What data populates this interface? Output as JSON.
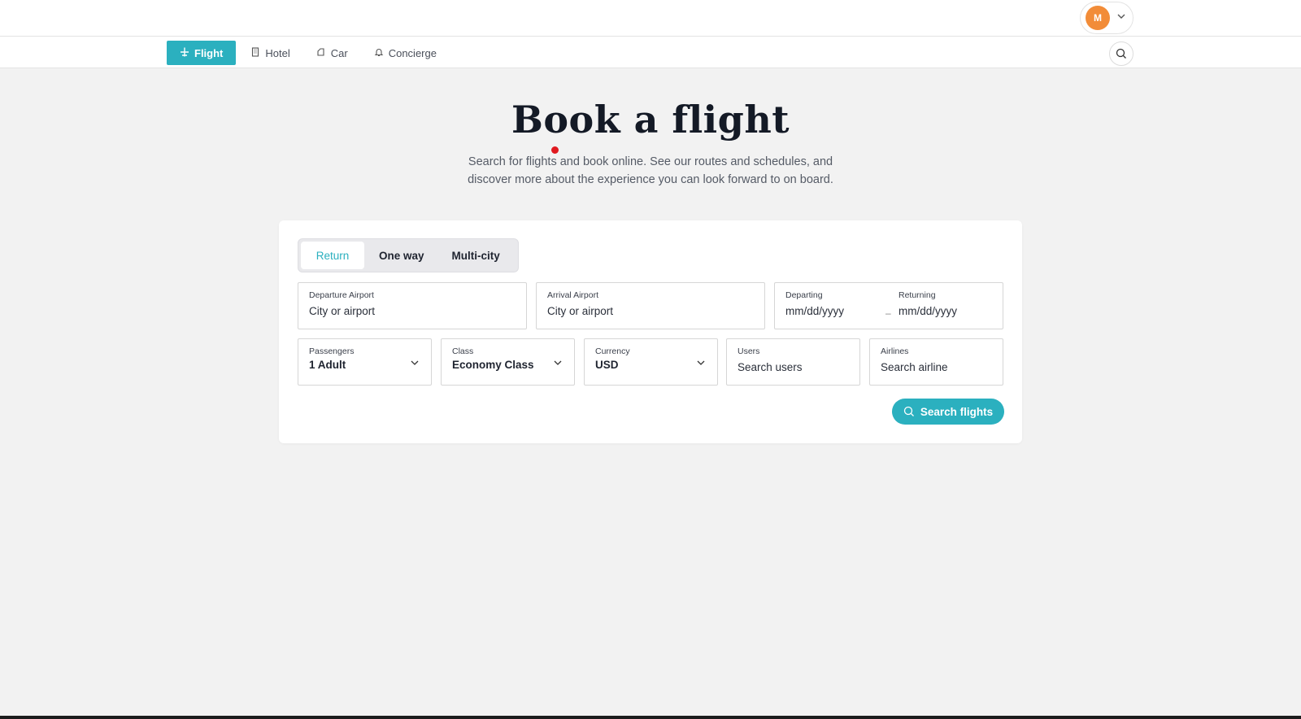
{
  "user_menu": {
    "avatar_initial": "M",
    "icon": "chevron-down-icon"
  },
  "nav": {
    "tabs": [
      {
        "label": "Flight",
        "icon": "plane-icon",
        "active": true
      },
      {
        "label": "Hotel",
        "icon": "building-icon",
        "active": false
      },
      {
        "label": "Car",
        "icon": "car-icon",
        "active": false
      },
      {
        "label": "Concierge",
        "icon": "bell-icon",
        "active": false
      }
    ],
    "search_icon": "search-icon"
  },
  "hero": {
    "title": "Book a flight",
    "subtitle": "Search for flights and book online. See our routes and schedules, and discover more about the experience you can look forward to on board."
  },
  "trip_type": {
    "options": [
      "Return",
      "One way",
      "Multi-city"
    ],
    "selected": "Return"
  },
  "fields": {
    "departure": {
      "label": "Departure Airport",
      "placeholder": "City or airport"
    },
    "arrival": {
      "label": "Arrival Airport",
      "placeholder": "City or airport"
    },
    "departing": {
      "label": "Departing",
      "placeholder": "mm/dd/yyyy"
    },
    "returning": {
      "label": "Returning",
      "placeholder": "mm/dd/yyyy"
    },
    "date_separator": "–",
    "passengers": {
      "label": "Passengers",
      "value": "1 Adult"
    },
    "class": {
      "label": "Class",
      "value": "Economy Class"
    },
    "currency": {
      "label": "Currency",
      "value": "USD"
    },
    "users": {
      "label": "Users",
      "placeholder": "Search users"
    },
    "airlines": {
      "label": "Airlines",
      "placeholder": "Search airline"
    }
  },
  "search_button": {
    "label": "Search flights"
  },
  "colors": {
    "accent": "#2bb0bf",
    "avatar": "#f28c38",
    "marker": "#e0191f"
  }
}
